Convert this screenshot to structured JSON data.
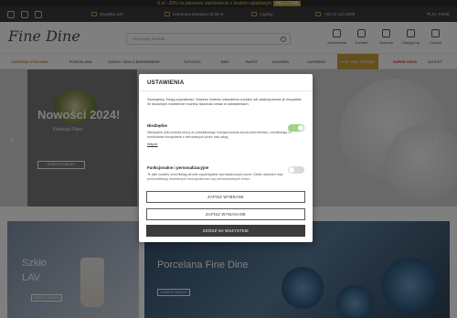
{
  "promo": {
    "text": "-5 zł - 20% na pierwsze zamówienie z kodem rabatowym:",
    "code": "WELCOME"
  },
  "infobar": {
    "social_icons": [
      "facebook-icon",
      "instagram-icon",
      "youtube-icon"
    ],
    "shipping": "Wysyłka 24h",
    "free_delivery": "Darmowa dostawa od 99 zł",
    "loyalty": "Lojalny",
    "phone": "+48 12 110 2908",
    "lang": "PLN | Polski"
  },
  "header": {
    "logo": "Fine Dine",
    "search_placeholder": "Wyszukaj produkt",
    "icons": [
      {
        "name": "zamowienia-icon",
        "label": "Zamówienia"
      },
      {
        "name": "contact-icon",
        "label": "Kontakt"
      },
      {
        "name": "favorites-icon",
        "label": "Ulubione"
      },
      {
        "name": "account-icon",
        "label": "Zaloguj się"
      },
      {
        "name": "cart-icon",
        "label": "Koszyk"
      }
    ]
  },
  "nav": {
    "items": [
      "ZASTAWA STOŁOWA",
      "PORCELANA",
      "SZKŁO I SZKŁO BARMAŃSKIE",
      "SZTUĆCE",
      "BAR",
      "BUFET",
      "KUCHNIA",
      "CATERING",
      "KOD. ZAD. ZESTAW",
      "SUPER CENA",
      "OUTLET"
    ]
  },
  "hero": {
    "title": "Nowości 2024!",
    "subtitle": "Kolekcja Piano",
    "button": "ZOBACZ WIĘCEJ"
  },
  "tiles": [
    {
      "title_line1": "Szkło",
      "title_line2": "LAV",
      "button": "ZOBACZ WIĘCEJ"
    },
    {
      "title": "Porcelana Fine Dine",
      "button": "ZOBACZ WIĘCEJ"
    }
  ],
  "modal": {
    "title": "USTAWIENIA",
    "intro": "Szanujemy Twoją prywatność. Możesz zmienić ustawienia cookies lub zaakceptować je wszystkie. W dowolnym momencie możesz dokonać zmian w ustawieniach.",
    "sections": [
      {
        "name": "Niezbędne",
        "desc": "Niezbędne pliki cookies służą do prawidłowego funkcjonowania strony internetowej i umożliwiają Ci komfortowe korzystanie z oferowanych przez nas usług.",
        "more": "Więcej",
        "enabled": true
      },
      {
        "name": "Funkcjonalne i personalizacyjne",
        "desc": "Te pliki cookies umożliwiają stronie zapamiętanie wprowadzonych przez Ciebie ustawień oraz personalizację określonych funkcjonalności czy prezentowanych treści.",
        "enabled": false
      }
    ],
    "buttons": {
      "save": "ZAPISZ WYBRANE",
      "required": "ZAPISZ WYMAGANE",
      "accept_all": "ZGÓDŹ NA WSZYSTKIE"
    }
  },
  "colors": {
    "accent": "#c7a13d",
    "toggle_on": "#9ed38a",
    "overlay": "rgba(0,0,0,0.5)"
  }
}
